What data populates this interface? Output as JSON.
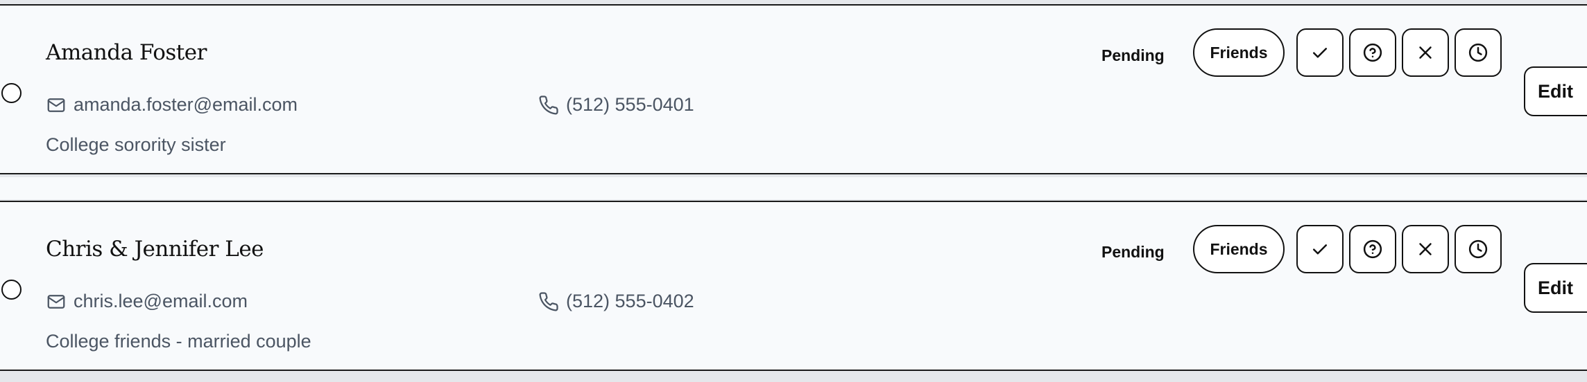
{
  "guests": [
    {
      "name": "Amanda Foster",
      "email": "amanda.foster@email.com",
      "phone": "(512) 555-0401",
      "note": "College sorority sister",
      "status": "Pending",
      "group": "Friends",
      "edit_label": "Edit"
    },
    {
      "name": "Chris & Jennifer Lee",
      "email": "chris.lee@email.com",
      "phone": "(512) 555-0402",
      "note": "College friends - married couple",
      "status": "Pending",
      "group": "Friends",
      "edit_label": "Edit"
    }
  ],
  "icons": {
    "email": "mail-icon",
    "phone": "phone-icon",
    "confirm": "check-icon",
    "maybe": "question-circle-icon",
    "decline": "x-icon",
    "pending": "clock-icon"
  }
}
